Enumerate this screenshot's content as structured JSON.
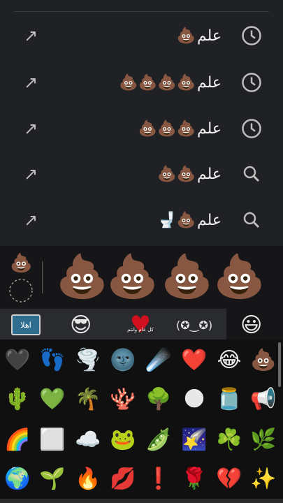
{
  "suggestions": [
    {
      "text": "علم",
      "emojis": "💩",
      "type": "history"
    },
    {
      "text": "علم",
      "emojis": "💩💩💩💩",
      "type": "history"
    },
    {
      "text": "علم",
      "emojis": "💩💩💩",
      "type": "history"
    },
    {
      "text": "علم",
      "emojis": "💩💩",
      "type": "search"
    },
    {
      "text": "علم",
      "emojis": "💩🚽",
      "type": "search"
    }
  ],
  "strip": {
    "small": "💩",
    "items": [
      "💩",
      "💩",
      "💩",
      "💩"
    ]
  },
  "categories": {
    "sticker_text": "اهلا",
    "heart_text": "كل عام وانتم بخير",
    "face": "😎",
    "kaomoji": "(✪‿✪)",
    "smile": "😃"
  },
  "grid": [
    [
      "🖤",
      "👣",
      "🌪️",
      "🌚",
      "☄️",
      "❤️",
      "😂",
      "💩"
    ],
    [
      "🌵",
      "💚",
      "🌴",
      "🪸",
      "🌳",
      "🌑",
      "🫙",
      "📢"
    ],
    [
      "🌈",
      "⬜",
      "☁️",
      "🐸",
      "🫛",
      "🌠",
      "☘️",
      "🌿"
    ],
    [
      "🌍",
      "🌱",
      "🔥",
      "💋",
      "❗",
      "🌹",
      "💔",
      "✨"
    ]
  ]
}
